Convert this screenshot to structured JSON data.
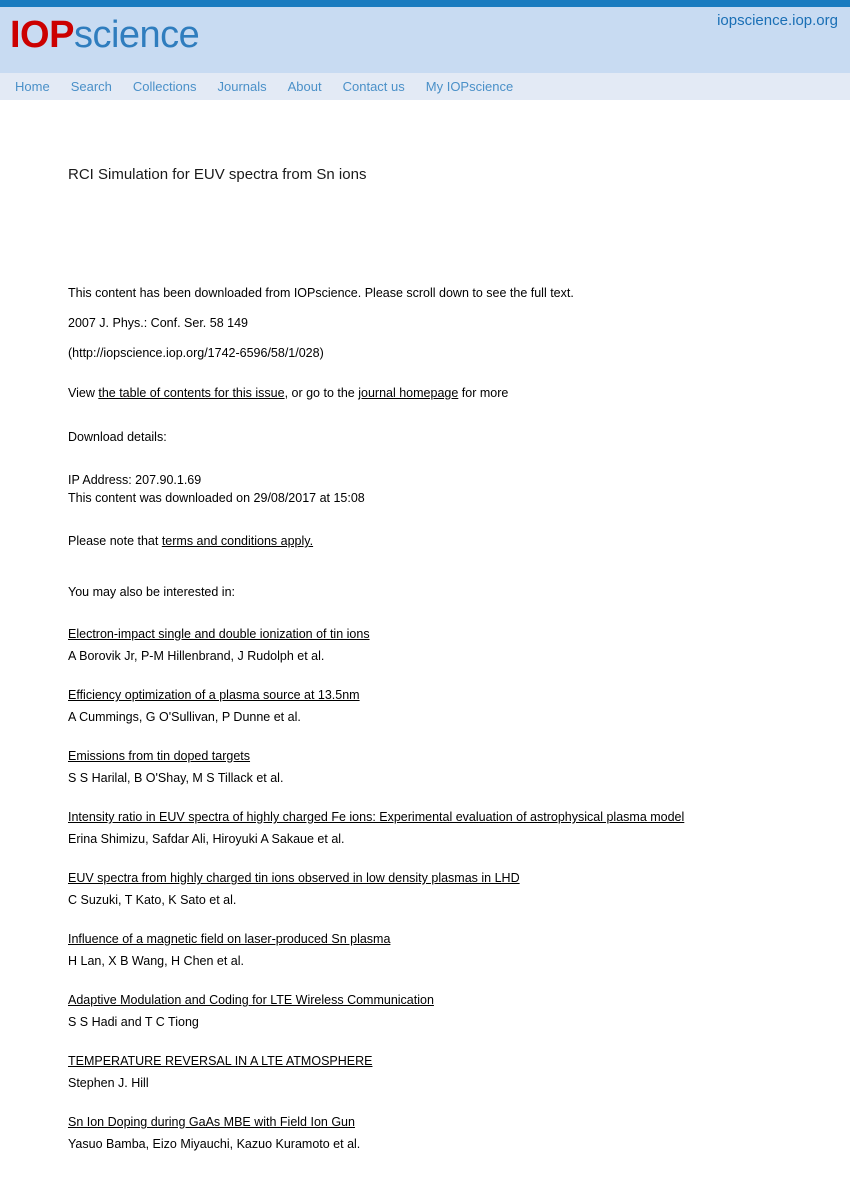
{
  "header": {
    "logo_primary": "IOP",
    "logo_secondary": "science",
    "site_url": "iopscience.iop.org",
    "accent_blue": "#1a7cc0",
    "band_blue": "#c8dbf2",
    "nav_band": "#e3eaf5",
    "logo_red": "#cc0000",
    "logo_blue": "#2f7dbe",
    "nav_link_color": "#4a90c8"
  },
  "nav": {
    "items": [
      {
        "label": "Home"
      },
      {
        "label": "Search"
      },
      {
        "label": "Collections"
      },
      {
        "label": "Journals"
      },
      {
        "label": "About"
      },
      {
        "label": "Contact us"
      },
      {
        "label": "My IOPscience"
      }
    ]
  },
  "article": {
    "title": "RCI Simulation for EUV spectra from Sn ions",
    "downloaded_notice": "This content has been downloaded from IOPscience. Please scroll down to see the full text.",
    "citation": "2007 J. Phys.: Conf. Ser. 58 149",
    "url_line": "(http://iopscience.iop.org/1742-6596/58/1/028)",
    "view_prefix": "View ",
    "toc_link": "the table of contents for this issue",
    "view_middle": ", or go to the ",
    "journal_link": "journal homepage",
    "view_suffix": " for more"
  },
  "download_details": {
    "heading": "Download details:",
    "ip_address": "IP Address: 207.90.1.69",
    "downloaded_on": "This content was downloaded on 29/08/2017 at 15:08",
    "terms_prefix": "Please note that ",
    "terms_link": "terms and conditions apply."
  },
  "related": {
    "heading": "You may also be interested in:",
    "items": [
      {
        "title": "Electron-impact single and double ionization of tin ions",
        "authors": "A Borovik Jr, P-M Hillenbrand, J Rudolph et al."
      },
      {
        "title": "Efficiency optimization of a plasma source at 13.5nm",
        "authors": "A Cummings, G O'Sullivan, P Dunne et al."
      },
      {
        "title": "Emissions from tin doped targets",
        "authors": "S S Harilal, B O'Shay, M S Tillack et al."
      },
      {
        "title": "Intensity ratio in EUV spectra of highly charged Fe ions: Experimental evaluation of astrophysical plasma model",
        "authors": "Erina Shimizu, Safdar Ali, Hiroyuki A Sakaue et al."
      },
      {
        "title": "EUV spectra from highly charged tin ions observed in low density plasmas in LHD",
        "authors": "C Suzuki, T Kato, K Sato et al."
      },
      {
        "title": "Influence of a magnetic field on laser-produced Sn plasma",
        "authors": "H Lan, X B Wang, H Chen et al."
      },
      {
        "title": "Adaptive Modulation and Coding for LTE Wireless Communication",
        "authors": "S S Hadi and T C Tiong"
      },
      {
        "title": "TEMPERATURE REVERSAL IN A LTE ATMOSPHERE",
        "authors": "Stephen J. Hill"
      },
      {
        "title": "Sn Ion Doping during GaAs MBE with Field Ion Gun",
        "authors": "Yasuo Bamba, Eizo Miyauchi, Kazuo Kuramoto et al."
      }
    ]
  }
}
